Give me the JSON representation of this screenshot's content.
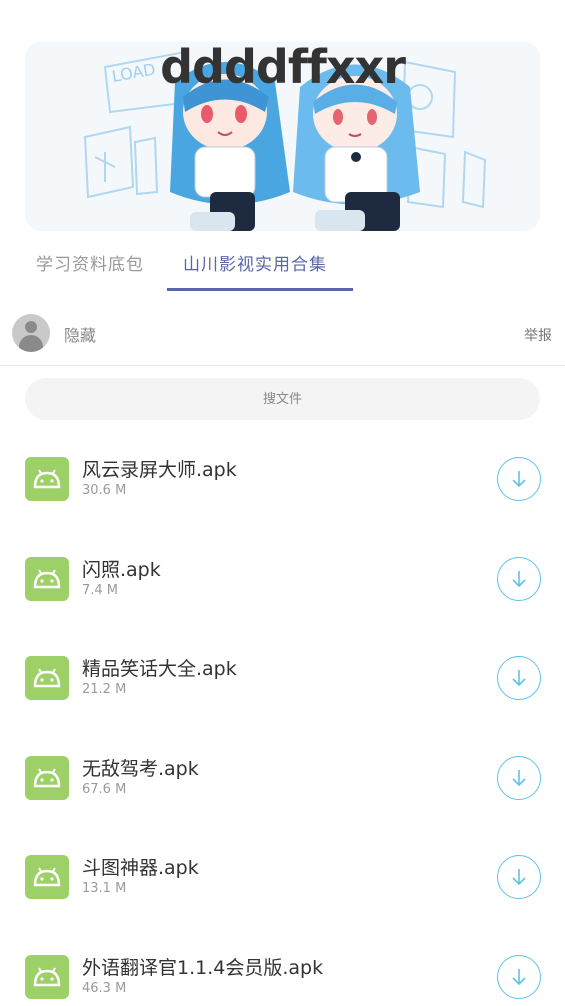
{
  "banner": {
    "title": "ddddffxxr",
    "image_name": "anime-characters-illustration"
  },
  "tabs": [
    {
      "label": "学习资料底包",
      "active": false
    },
    {
      "label": "山川影视实用合集",
      "active": true
    }
  ],
  "user": {
    "name": "隐藏",
    "report_label": "举报"
  },
  "search": {
    "placeholder": "搜文件"
  },
  "files": [
    {
      "name": "风云录屏大师.apk",
      "size": "30.6 M",
      "icon": "android-icon"
    },
    {
      "name": "闪照.apk",
      "size": "7.4 M",
      "icon": "android-icon"
    },
    {
      "name": "精品笑话大全.apk",
      "size": "21.2 M",
      "icon": "android-icon"
    },
    {
      "name": "无敌驾考.apk",
      "size": "67.6 M",
      "icon": "android-icon"
    },
    {
      "name": "斗图神器.apk",
      "size": "13.1 M",
      "icon": "android-icon"
    },
    {
      "name": "外语翻译官1.1.4会员版.apk",
      "size": "46.3 M",
      "icon": "android-icon"
    }
  ],
  "colors": {
    "accent": "#5a66a8",
    "android_green": "#9dd067",
    "download_blue": "#5fc2ea"
  }
}
